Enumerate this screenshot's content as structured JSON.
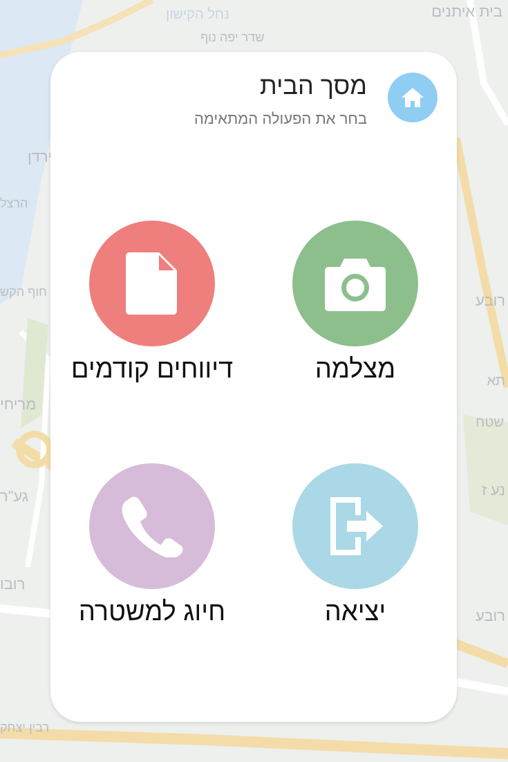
{
  "map": {
    "labels": [
      "בית איתנים",
      "הרצל",
      "ירדן",
      "מריחי",
      "רובע",
      "נע ז",
      "רובע",
      "חוף הקש",
      "גע\"ר",
      "רבין יצחק",
      "שדר יפה נוף",
      "נחל הקישון",
      "רובו",
      "שטח",
      "תא"
    ]
  },
  "header": {
    "icon": "home-icon",
    "title": "מסך הבית",
    "subtitle": "בחר את הפעולה המתאימה"
  },
  "actions": {
    "camera": {
      "label": "מצלמה",
      "icon": "camera-icon",
      "color": "#8dbf8d"
    },
    "reports": {
      "label": "דיווחים קודמים",
      "icon": "document-icon",
      "color": "#ee7f7d"
    },
    "exit": {
      "label": "יציאה",
      "icon": "exit-icon",
      "color": "#abd8e6"
    },
    "police": {
      "label": "חיוג למשטרה",
      "icon": "phone-icon",
      "color": "#d6bcd9"
    }
  },
  "colors": {
    "header_icon_bg": "#8fcdf3",
    "card_bg": "#ffffff"
  }
}
